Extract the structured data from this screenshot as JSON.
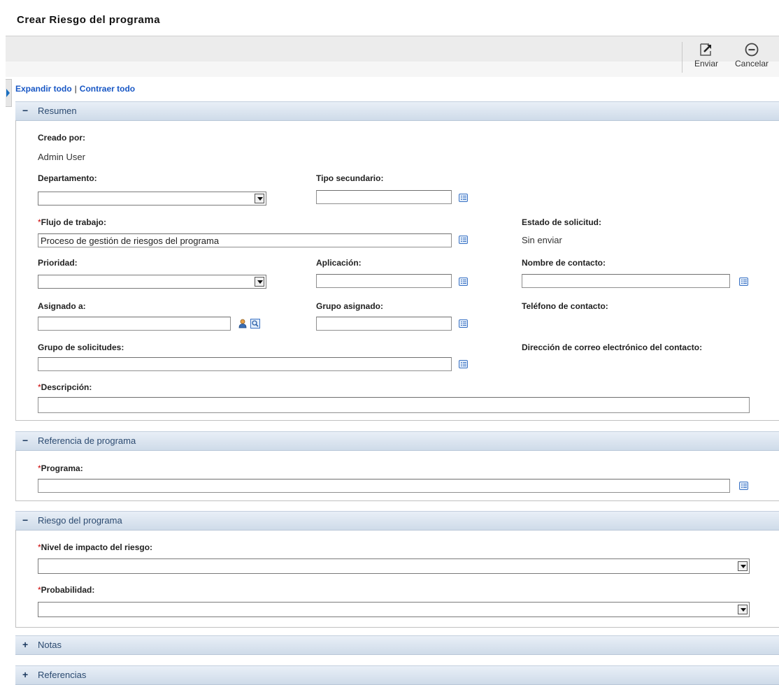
{
  "page": {
    "title": "Crear Riesgo del programa"
  },
  "toolbar": {
    "submit_label": "Enviar",
    "cancel_label": "Cancelar"
  },
  "links": {
    "expand_all": "Expandir todo",
    "separator": "|",
    "collapse_all": "Contraer todo"
  },
  "icons": [
    "submit-icon",
    "cancel-icon",
    "list-icon",
    "user-icon",
    "search-icon"
  ],
  "sections": {
    "resumen": {
      "title": "Resumen",
      "toggle": "−",
      "created_by_label": "Creado por:",
      "created_by_value": "Admin User",
      "department_label": "Departamento:",
      "department_value": "",
      "subtype_label": "Tipo secundario:",
      "subtype_value": "",
      "workflow_required": "*",
      "workflow_label": "Flujo de trabajo:",
      "workflow_value": "Proceso de gestión de riesgos del programa",
      "request_status_label": "Estado de solicitud:",
      "request_status_value": "Sin enviar",
      "priority_label": "Prioridad:",
      "priority_value": "",
      "application_label": "Aplicación:",
      "application_value": "",
      "contact_name_label": "Nombre de contacto:",
      "contact_name_value": "",
      "assigned_to_label": "Asignado a:",
      "assigned_to_value": "",
      "assigned_group_label": "Grupo asignado:",
      "assigned_group_value": "",
      "contact_phone_label": "Teléfono de contacto:",
      "request_group_label": "Grupo de solicitudes:",
      "request_group_value": "",
      "contact_email_label": "Dirección de correo electrónico del contacto:",
      "description_required": "*",
      "description_label": "Descripción:",
      "description_value": ""
    },
    "program_reference": {
      "title": "Referencia de programa",
      "toggle": "−",
      "program_required": "*",
      "program_label": "Programa:",
      "program_value": ""
    },
    "program_risk": {
      "title": "Riesgo del programa",
      "toggle": "−",
      "impact_required": "*",
      "impact_label": "Nivel de impacto del riesgo:",
      "impact_value": "",
      "probability_required": "*",
      "probability_label": "Probabilidad:",
      "probability_value": ""
    },
    "notes": {
      "title": "Notas",
      "toggle": "+"
    },
    "references": {
      "title": "Referencias",
      "toggle": "+"
    }
  }
}
